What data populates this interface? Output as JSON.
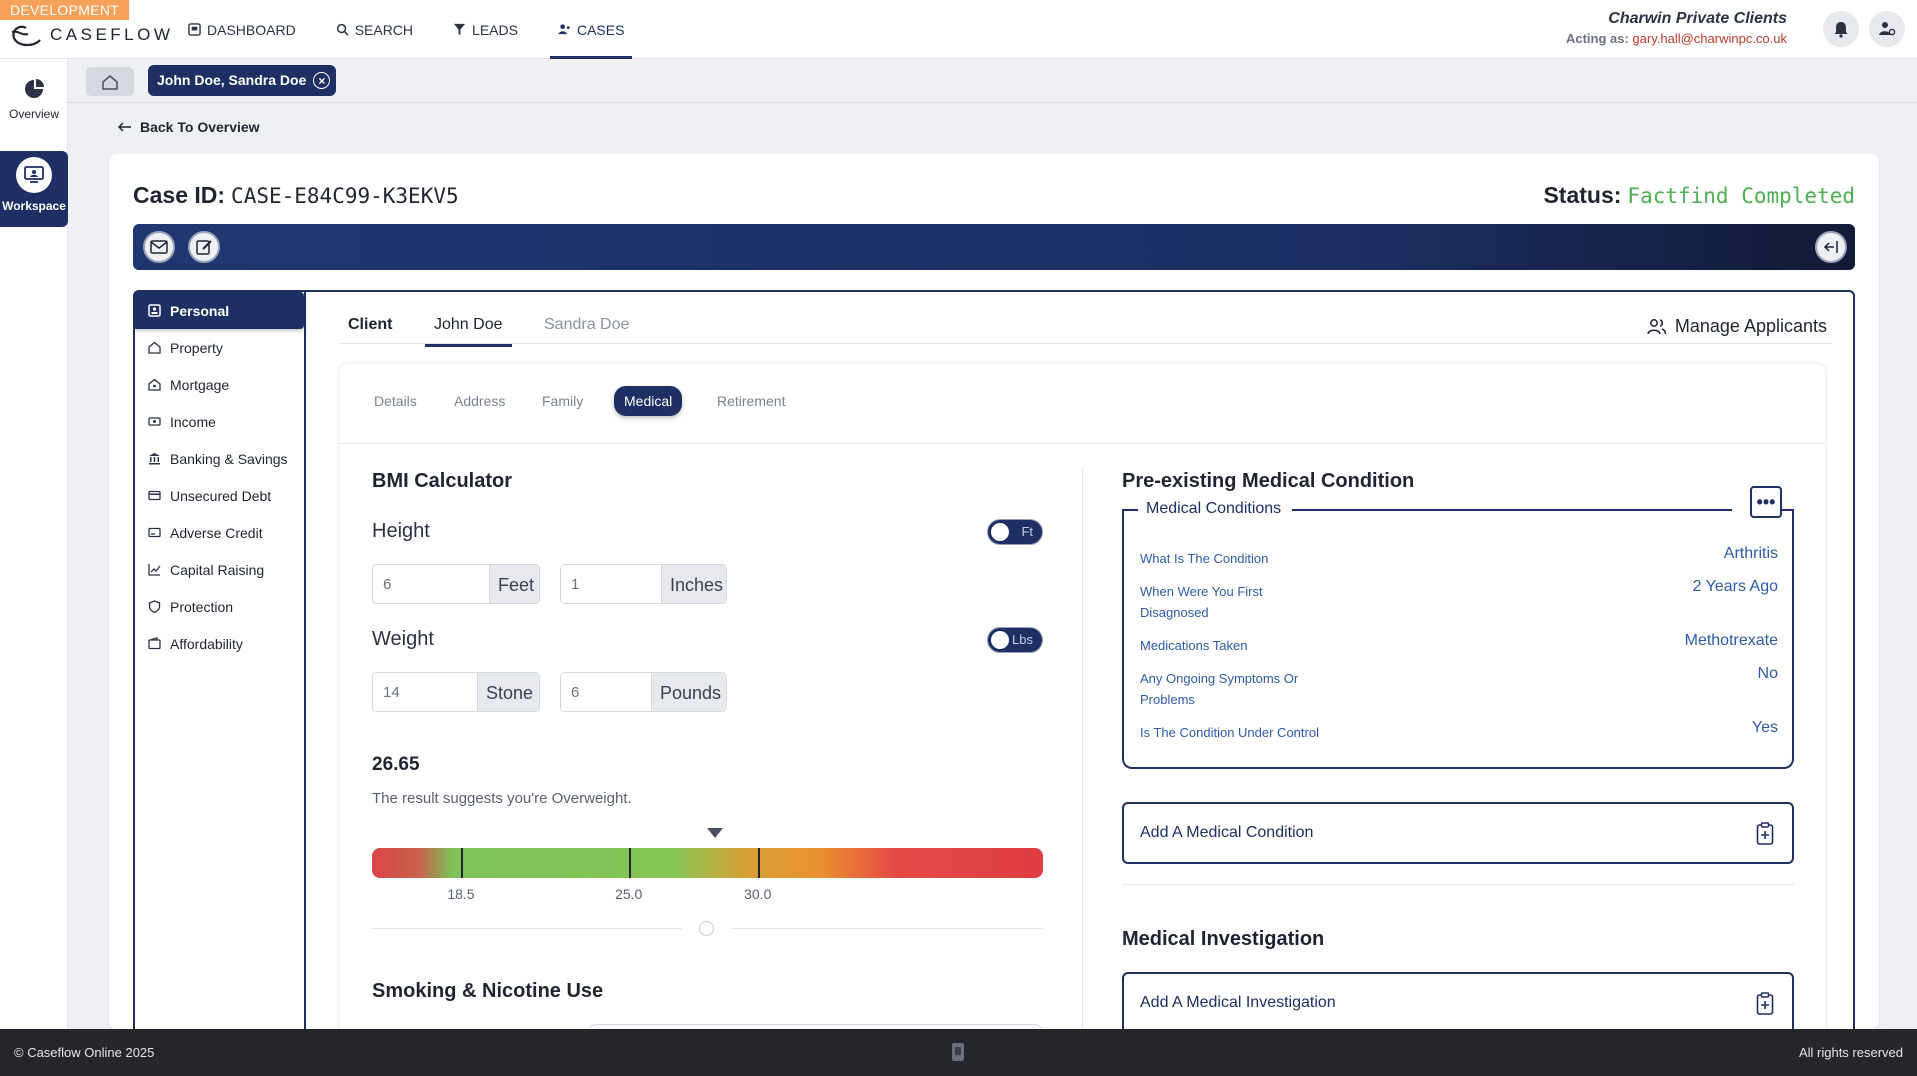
{
  "env_badge": "DEVELOPMENT",
  "brand": {
    "name": "CASEFLOW"
  },
  "nav": [
    {
      "label": "DASHBOARD",
      "icon": "dashboard-icon"
    },
    {
      "label": "SEARCH",
      "icon": "search-icon"
    },
    {
      "label": "LEADS",
      "icon": "funnel-icon"
    },
    {
      "label": "CASES",
      "icon": "users-icon",
      "active": true
    }
  ],
  "org": {
    "name": "Charwin Private Clients",
    "acting_label": "Acting as:",
    "acting_user": "gary.hall@charwinpc.co.uk"
  },
  "rail": [
    {
      "label": "Overview",
      "icon": "pie-chart-icon"
    },
    {
      "label": "Workspace",
      "icon": "monitor-user-icon",
      "active": true
    }
  ],
  "open_tab": {
    "label": "John Doe, Sandra Doe"
  },
  "back_label": "Back To Overview",
  "case": {
    "id_label": "Case ID:",
    "id": "CASE-E84C99-K3EKV5",
    "status_label": "Status:",
    "status": "Factfind Completed"
  },
  "side_menu": [
    {
      "label": "Personal",
      "icon": "id-card-icon",
      "active": true
    },
    {
      "label": "Property",
      "icon": "house-icon"
    },
    {
      "label": "Mortgage",
      "icon": "house-key-icon"
    },
    {
      "label": "Income",
      "icon": "cash-icon"
    },
    {
      "label": "Banking & Savings",
      "icon": "bank-icon"
    },
    {
      "label": "Unsecured Debt",
      "icon": "credit-card-icon"
    },
    {
      "label": "Adverse Credit",
      "icon": "card-warning-icon"
    },
    {
      "label": "Capital Raising",
      "icon": "line-chart-icon"
    },
    {
      "label": "Protection",
      "icon": "shield-icon"
    },
    {
      "label": "Affordability",
      "icon": "wallet-icon"
    }
  ],
  "client_tabs": {
    "label": "Client",
    "applicant_1": "John Doe",
    "applicant_2": "Sandra Doe",
    "manage": "Manage Applicants"
  },
  "sub_tabs": [
    "Details",
    "Address",
    "Family",
    "Medical",
    "Retirement"
  ],
  "bmi": {
    "title": "BMI Calculator",
    "height_label": "Height",
    "height_unit_toggle": "Ft",
    "feet": "6",
    "feet_unit": "Feet",
    "inches": "1",
    "inches_unit": "Inches",
    "weight_label": "Weight",
    "weight_unit_toggle": "Lbs",
    "stone": "14",
    "stone_unit": "Stone",
    "pounds": "6",
    "pounds_unit": "Pounds",
    "result": "26.65",
    "result_text": "The result suggests you're Overweight.",
    "scale_min": 15,
    "scale_max": 41,
    "thresholds": [
      "18.5",
      "25.0",
      "30.0"
    ],
    "marker_value": 28.3
  },
  "smoking": {
    "title": "Smoking & Nicotine Use"
  },
  "medical": {
    "title": "Pre-existing Medical Condition",
    "group_label": "Medical Conditions",
    "rows": [
      {
        "key": "What Is The Condition",
        "value": "Arthritis"
      },
      {
        "key": "When Were You First Disagnosed",
        "value": "2 Years Ago"
      },
      {
        "key": "Medications Taken",
        "value": "Methotrexate"
      },
      {
        "key": "Any Ongoing Symptoms Or Problems",
        "value": "No"
      },
      {
        "key": "Is The Condition Under Control",
        "value": "Yes"
      }
    ],
    "add_condition": "Add A Medical Condition",
    "investigation_title": "Medical Investigation",
    "add_investigation": "Add A Medical Investigation"
  },
  "footer": {
    "left": "© Caseflow Online 2025",
    "right": "All rights reserved"
  },
  "colors": {
    "primary": "#1d2f63",
    "status": "#4caf50",
    "dev": "#f6a15a",
    "link": "#2e5aa8"
  }
}
